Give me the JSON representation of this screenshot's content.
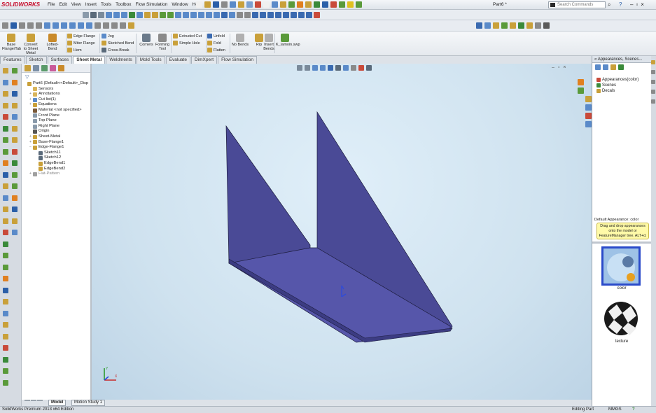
{
  "app": {
    "brand": "SOLIDWORKS",
    "doc_title": "Part6 *",
    "menu": [
      "File",
      "Edit",
      "View",
      "Insert",
      "Tools",
      "Toolbox",
      "Flow Simulation",
      "Window",
      "Help"
    ],
    "search_placeholder": "Search Commands"
  },
  "command_manager": {
    "big": [
      {
        "label": "Base Flange/Tab",
        "icon": "base-flange-icon",
        "color": "#c9a03a"
      },
      {
        "label": "Convert to Sheet Metal",
        "icon": "convert-sheet-metal-icon",
        "color": "#c9a03a"
      },
      {
        "label": "Lofted-Bend",
        "icon": "lofted-bend-icon",
        "color": "#c98a2a"
      },
      {
        "label": "Corners",
        "icon": "corners-icon",
        "color": "#6a7a8a"
      },
      {
        "label": "Forming Tool",
        "icon": "forming-tool-icon",
        "color": "#8a8a8a"
      },
      {
        "label": "No Bends",
        "icon": "no-bends-icon",
        "color": "#b0b0b0"
      },
      {
        "label": "Rip",
        "icon": "rip-icon",
        "color": "#c9a03a"
      },
      {
        "label": "Insert Bends",
        "icon": "insert-bends-icon",
        "color": "#b0b0b0"
      },
      {
        "label": "K_Iamoin.swp",
        "icon": "macro-icon",
        "color": "#5a9a3a"
      }
    ],
    "small": [
      {
        "label": "Edge Flange",
        "icon": "edge-flange-icon"
      },
      {
        "label": "Miter Flange",
        "icon": "miter-flange-icon"
      },
      {
        "label": "Hem",
        "icon": "hem-icon"
      },
      {
        "label": "Jog",
        "icon": "jog-icon"
      },
      {
        "label": "Sketched Bend",
        "icon": "sketched-bend-icon"
      },
      {
        "label": "Cross-Break",
        "icon": "cross-break-icon"
      },
      {
        "label": "Extruded Cut",
        "icon": "extruded-cut-icon"
      },
      {
        "label": "Simple Hole",
        "icon": "simple-hole-icon"
      },
      {
        "label": "Unfold",
        "icon": "unfold-icon"
      },
      {
        "label": "Fold",
        "icon": "fold-icon"
      },
      {
        "label": "Flatten",
        "icon": "flatten-icon"
      }
    ]
  },
  "tabs": [
    "Features",
    "Sketch",
    "Surfaces",
    "Sheet Metal",
    "Weldments",
    "Mold Tools",
    "Evaluate",
    "DimXpert",
    "Flow Simulation"
  ],
  "active_tab": "Sheet Metal",
  "feature_tree": {
    "filter_icon": "filter-icon",
    "nodes": [
      {
        "label": "Part6  (Default<<Default>_Disp",
        "icon": "part-icon",
        "color": "#c9a03a",
        "indent": 0,
        "expander": ""
      },
      {
        "label": "Sensors",
        "icon": "sensors-folder-icon",
        "color": "#d8b45a",
        "indent": 1,
        "expander": ""
      },
      {
        "label": "Annotations",
        "icon": "annotations-icon",
        "color": "#d8b45a",
        "indent": 1,
        "expander": "+"
      },
      {
        "label": "Cut list(1)",
        "icon": "cut-list-icon",
        "color": "#5a8ac9",
        "indent": 1,
        "expander": "+"
      },
      {
        "label": "Equations",
        "icon": "equations-icon",
        "color": "#c9a03a",
        "indent": 1,
        "expander": "+"
      },
      {
        "label": "Material <not specified>",
        "icon": "material-icon",
        "color": "#7a5a3a",
        "indent": 1,
        "expander": ""
      },
      {
        "label": "Front Plane",
        "icon": "plane-icon",
        "color": "#8a9aaa",
        "indent": 1,
        "expander": ""
      },
      {
        "label": "Top Plane",
        "icon": "plane-icon",
        "color": "#8a9aaa",
        "indent": 1,
        "expander": ""
      },
      {
        "label": "Right Plane",
        "icon": "plane-icon",
        "color": "#8a9aaa",
        "indent": 1,
        "expander": ""
      },
      {
        "label": "Origin",
        "icon": "origin-icon",
        "color": "#555555",
        "indent": 1,
        "expander": ""
      },
      {
        "label": "Sheet-Metal",
        "icon": "sheet-metal-icon",
        "color": "#c9a03a",
        "indent": 1,
        "expander": "+"
      },
      {
        "label": "Base-Flange1",
        "icon": "base-flange-icon",
        "color": "#c9a03a",
        "indent": 1,
        "expander": "+"
      },
      {
        "label": "Edge-Flange1",
        "icon": "edge-flange-icon",
        "color": "#c9a03a",
        "indent": 1,
        "expander": "−"
      },
      {
        "label": "Sketch11",
        "icon": "sketch-icon",
        "color": "#5a6a7a",
        "indent": 2,
        "expander": ""
      },
      {
        "label": "Sketch12",
        "icon": "sketch-icon",
        "color": "#5a6a7a",
        "indent": 2,
        "expander": ""
      },
      {
        "label": "EdgeBend1",
        "icon": "edge-bend-icon",
        "color": "#c9a03a",
        "indent": 2,
        "expander": ""
      },
      {
        "label": "EdgeBend2",
        "icon": "edge-bend-icon",
        "color": "#c9a03a",
        "indent": 2,
        "expander": ""
      },
      {
        "label": "Flat-Pattern",
        "icon": "flat-pattern-icon",
        "color": "#a0a0a0",
        "indent": 1,
        "expander": "+",
        "dim": true
      }
    ]
  },
  "bottom_tabs": [
    "Model",
    "Motion Study 1"
  ],
  "status": {
    "edition": "SolidWorks Premium 2013 x64 Edition",
    "mode": "Editing Part",
    "units": "MMGS",
    "colors": {
      "part_face": "#4a4a96",
      "part_face_inner": "#5656aa",
      "part_edge": "#1c1c3c"
    }
  },
  "task_pane": {
    "header": "Appearances, Scenes...",
    "tree": [
      {
        "label": "Appearances(color)",
        "icon": "appearances-icon",
        "color": "#c94a3a"
      },
      {
        "label": "Scenes",
        "icon": "scenes-icon",
        "color": "#3a8a3a"
      },
      {
        "label": "Decals",
        "icon": "decals-icon",
        "color": "#c9a03a"
      }
    ],
    "default_appearance": "Default Appearance: color",
    "tip": "Drag and drop appearances onto the model or FeatureManager tree.  ALT+d.",
    "swatches": [
      {
        "label": "color",
        "icon": "color-swatch-icon"
      },
      {
        "label": "texture",
        "icon": "texture-swatch-icon"
      }
    ]
  }
}
